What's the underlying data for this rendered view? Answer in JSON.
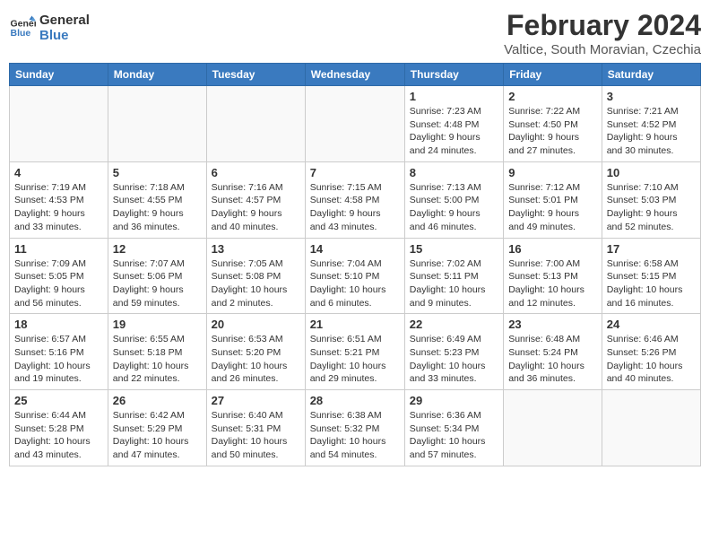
{
  "header": {
    "logo_line1": "General",
    "logo_line2": "Blue",
    "month": "February 2024",
    "location": "Valtice, South Moravian, Czechia"
  },
  "weekdays": [
    "Sunday",
    "Monday",
    "Tuesday",
    "Wednesday",
    "Thursday",
    "Friday",
    "Saturday"
  ],
  "weeks": [
    [
      {
        "day": "",
        "info": ""
      },
      {
        "day": "",
        "info": ""
      },
      {
        "day": "",
        "info": ""
      },
      {
        "day": "",
        "info": ""
      },
      {
        "day": "1",
        "info": "Sunrise: 7:23 AM\nSunset: 4:48 PM\nDaylight: 9 hours\nand 24 minutes."
      },
      {
        "day": "2",
        "info": "Sunrise: 7:22 AM\nSunset: 4:50 PM\nDaylight: 9 hours\nand 27 minutes."
      },
      {
        "day": "3",
        "info": "Sunrise: 7:21 AM\nSunset: 4:52 PM\nDaylight: 9 hours\nand 30 minutes."
      }
    ],
    [
      {
        "day": "4",
        "info": "Sunrise: 7:19 AM\nSunset: 4:53 PM\nDaylight: 9 hours\nand 33 minutes."
      },
      {
        "day": "5",
        "info": "Sunrise: 7:18 AM\nSunset: 4:55 PM\nDaylight: 9 hours\nand 36 minutes."
      },
      {
        "day": "6",
        "info": "Sunrise: 7:16 AM\nSunset: 4:57 PM\nDaylight: 9 hours\nand 40 minutes."
      },
      {
        "day": "7",
        "info": "Sunrise: 7:15 AM\nSunset: 4:58 PM\nDaylight: 9 hours\nand 43 minutes."
      },
      {
        "day": "8",
        "info": "Sunrise: 7:13 AM\nSunset: 5:00 PM\nDaylight: 9 hours\nand 46 minutes."
      },
      {
        "day": "9",
        "info": "Sunrise: 7:12 AM\nSunset: 5:01 PM\nDaylight: 9 hours\nand 49 minutes."
      },
      {
        "day": "10",
        "info": "Sunrise: 7:10 AM\nSunset: 5:03 PM\nDaylight: 9 hours\nand 52 minutes."
      }
    ],
    [
      {
        "day": "11",
        "info": "Sunrise: 7:09 AM\nSunset: 5:05 PM\nDaylight: 9 hours\nand 56 minutes."
      },
      {
        "day": "12",
        "info": "Sunrise: 7:07 AM\nSunset: 5:06 PM\nDaylight: 9 hours\nand 59 minutes."
      },
      {
        "day": "13",
        "info": "Sunrise: 7:05 AM\nSunset: 5:08 PM\nDaylight: 10 hours\nand 2 minutes."
      },
      {
        "day": "14",
        "info": "Sunrise: 7:04 AM\nSunset: 5:10 PM\nDaylight: 10 hours\nand 6 minutes."
      },
      {
        "day": "15",
        "info": "Sunrise: 7:02 AM\nSunset: 5:11 PM\nDaylight: 10 hours\nand 9 minutes."
      },
      {
        "day": "16",
        "info": "Sunrise: 7:00 AM\nSunset: 5:13 PM\nDaylight: 10 hours\nand 12 minutes."
      },
      {
        "day": "17",
        "info": "Sunrise: 6:58 AM\nSunset: 5:15 PM\nDaylight: 10 hours\nand 16 minutes."
      }
    ],
    [
      {
        "day": "18",
        "info": "Sunrise: 6:57 AM\nSunset: 5:16 PM\nDaylight: 10 hours\nand 19 minutes."
      },
      {
        "day": "19",
        "info": "Sunrise: 6:55 AM\nSunset: 5:18 PM\nDaylight: 10 hours\nand 22 minutes."
      },
      {
        "day": "20",
        "info": "Sunrise: 6:53 AM\nSunset: 5:20 PM\nDaylight: 10 hours\nand 26 minutes."
      },
      {
        "day": "21",
        "info": "Sunrise: 6:51 AM\nSunset: 5:21 PM\nDaylight: 10 hours\nand 29 minutes."
      },
      {
        "day": "22",
        "info": "Sunrise: 6:49 AM\nSunset: 5:23 PM\nDaylight: 10 hours\nand 33 minutes."
      },
      {
        "day": "23",
        "info": "Sunrise: 6:48 AM\nSunset: 5:24 PM\nDaylight: 10 hours\nand 36 minutes."
      },
      {
        "day": "24",
        "info": "Sunrise: 6:46 AM\nSunset: 5:26 PM\nDaylight: 10 hours\nand 40 minutes."
      }
    ],
    [
      {
        "day": "25",
        "info": "Sunrise: 6:44 AM\nSunset: 5:28 PM\nDaylight: 10 hours\nand 43 minutes."
      },
      {
        "day": "26",
        "info": "Sunrise: 6:42 AM\nSunset: 5:29 PM\nDaylight: 10 hours\nand 47 minutes."
      },
      {
        "day": "27",
        "info": "Sunrise: 6:40 AM\nSunset: 5:31 PM\nDaylight: 10 hours\nand 50 minutes."
      },
      {
        "day": "28",
        "info": "Sunrise: 6:38 AM\nSunset: 5:32 PM\nDaylight: 10 hours\nand 54 minutes."
      },
      {
        "day": "29",
        "info": "Sunrise: 6:36 AM\nSunset: 5:34 PM\nDaylight: 10 hours\nand 57 minutes."
      },
      {
        "day": "",
        "info": ""
      },
      {
        "day": "",
        "info": ""
      }
    ]
  ]
}
